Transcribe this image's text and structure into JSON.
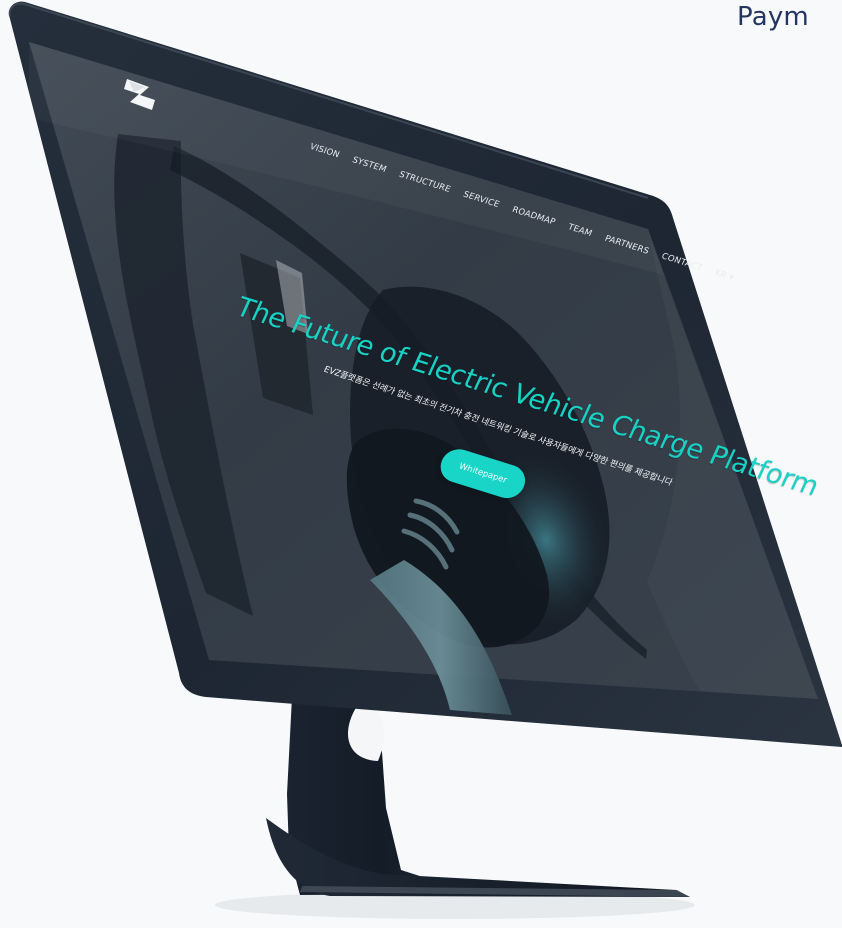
{
  "corner": {
    "title": "Paym"
  },
  "site": {
    "nav_items": [
      "VISION",
      "SYSTEM",
      "STRUCTURE",
      "SERVICE",
      "ROADMAP",
      "TEAM",
      "PARTNERS",
      "CONTACT",
      "KR ▾"
    ],
    "hero_title": "The Future of Electric Vehicle Charge Platform",
    "hero_subtitle": "EVZ플랫폼은 선례가 없는 최초의 전기차 충전 네트워킹 기술로 사용자들에게 다양한 편의를 제공합니다",
    "cta_label": "Whitepaper"
  },
  "icons": [
    "brand-logo-icon"
  ],
  "colors": {
    "background": "#f8f9fa",
    "device_frame": "#1b2532",
    "screen_base": "#384451",
    "accent": "#18d5c7",
    "nav_text": "#e8edf1",
    "corner_title": "#233560"
  }
}
